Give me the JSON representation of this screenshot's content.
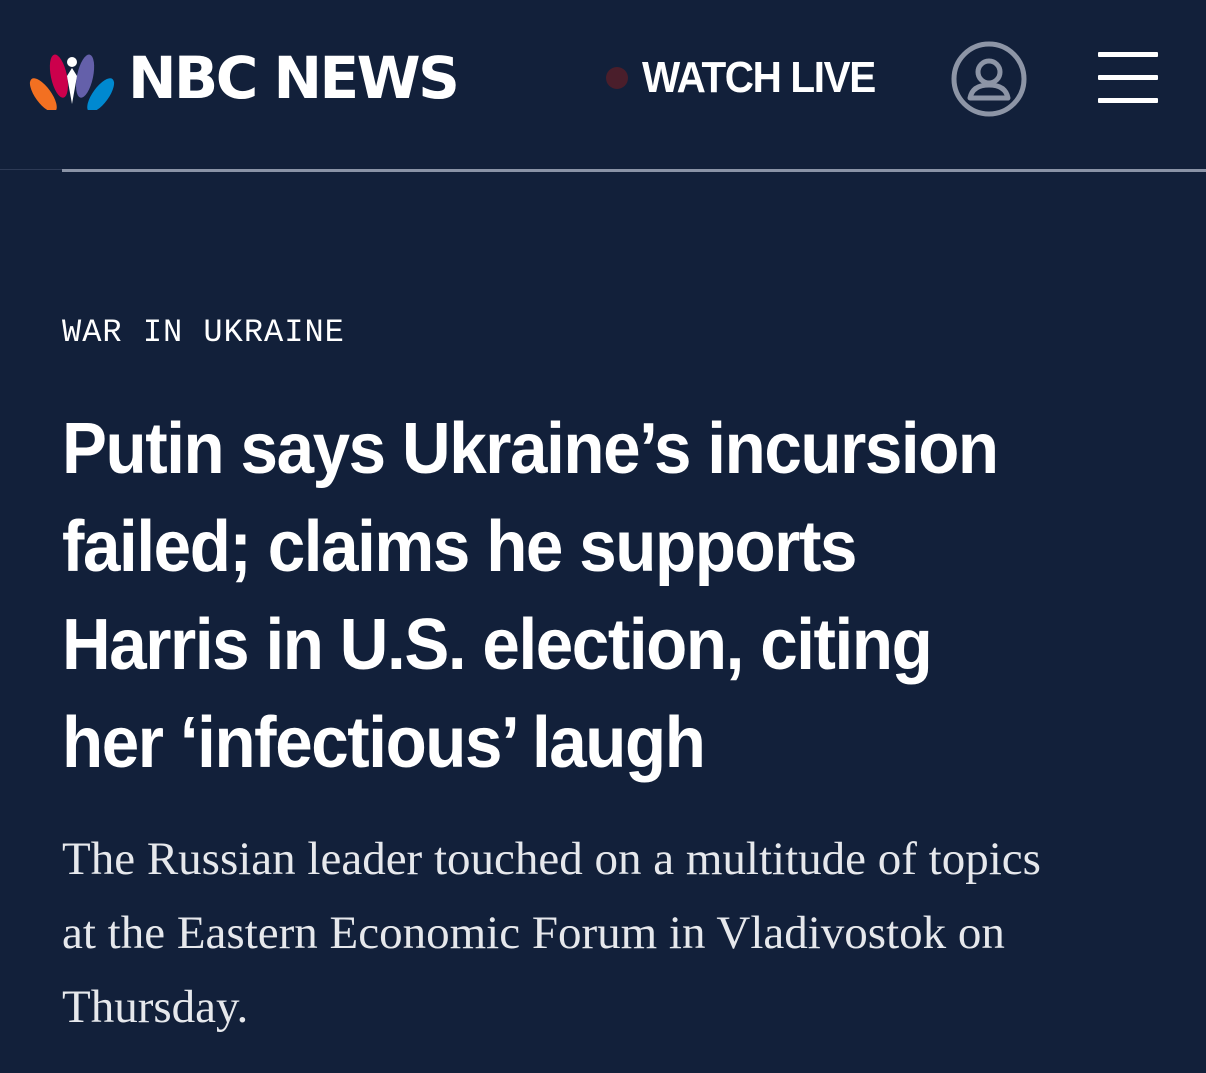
{
  "header": {
    "logo_text": "NBC NEWS",
    "logo_icon": "nbc-peacock-icon",
    "watch_live_label": "WATCH LIVE",
    "account_icon": "user-account-icon",
    "menu_icon": "hamburger-menu-icon"
  },
  "article": {
    "kicker": "WAR IN UKRAINE",
    "headline_lines": [
      "Putin says Ukraine’s incursion",
      "failed; claims he supports",
      "Harris in U.S. election, citing",
      "her ‘infectious’ laugh"
    ],
    "dek_lines": [
      "The Russian leader touched on a multitude of topics",
      "at the Eastern Economic Forum in Vladivostok on",
      "Thursday."
    ]
  },
  "colors": {
    "background": "#12203a",
    "text": "#ffffff",
    "live_dot": "#4a1e2b",
    "divider": "#8a93a6",
    "peacock_yellow": "#fcb711",
    "peacock_orange": "#f37021",
    "peacock_red": "#cc004c",
    "peacock_purple": "#6460aa",
    "peacock_blue": "#0089d0",
    "peacock_green": "#0db14b"
  }
}
